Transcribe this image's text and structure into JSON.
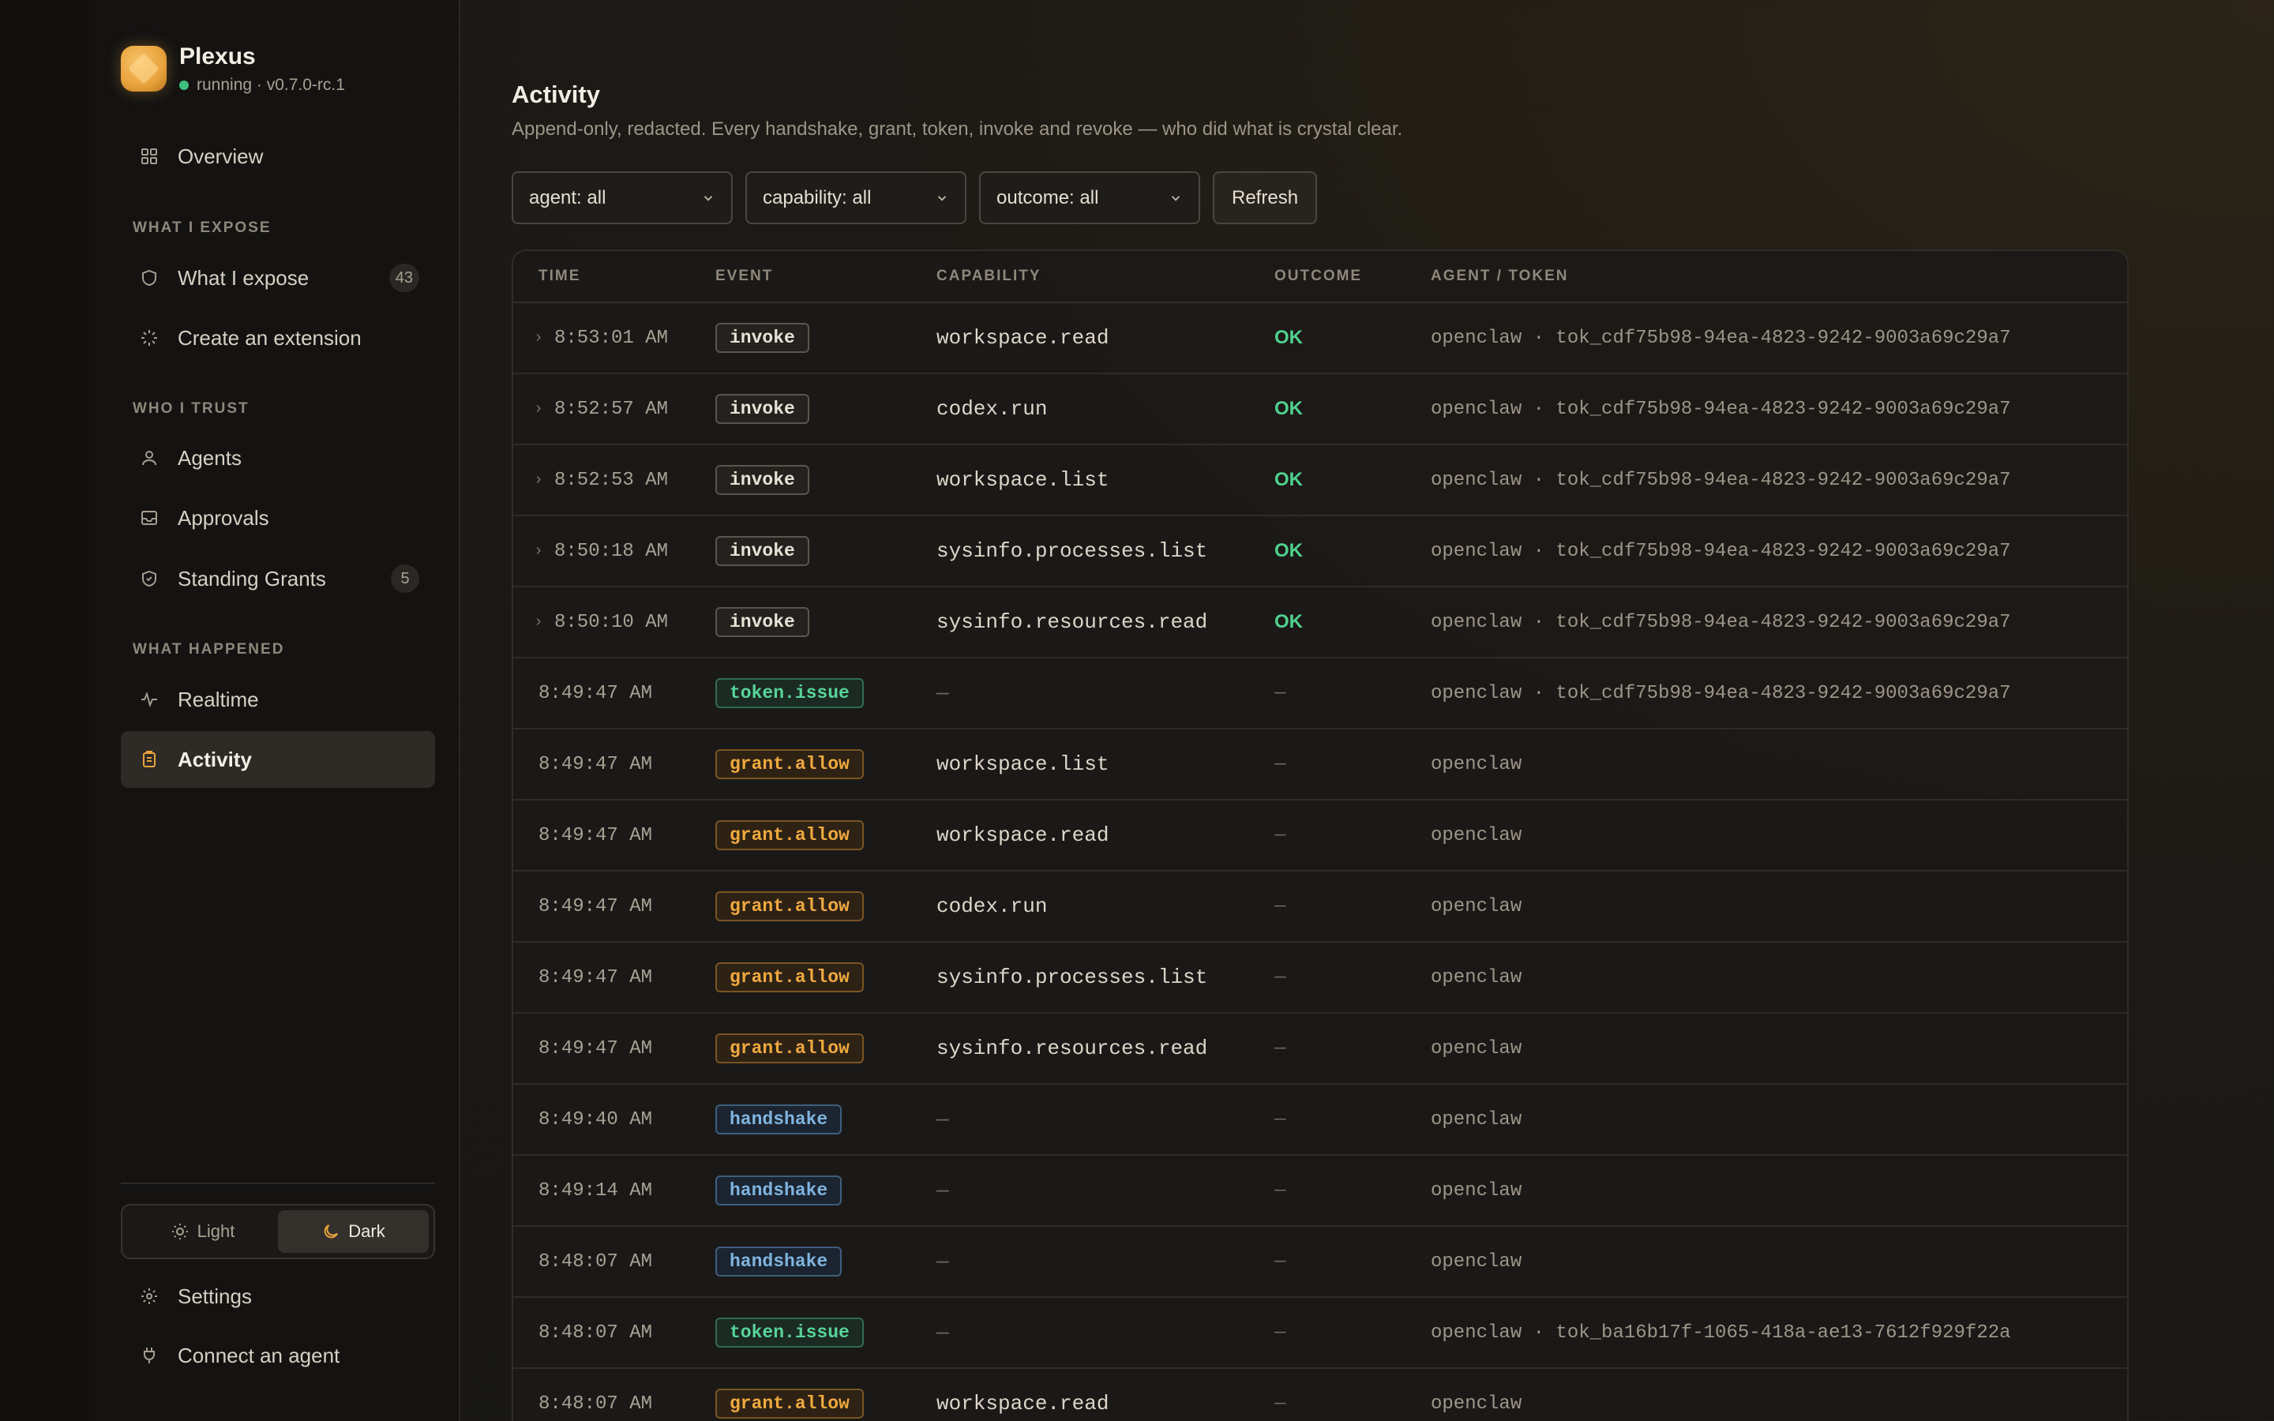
{
  "app": {
    "name": "Plexus",
    "status": "running · v0.7.0-rc.1"
  },
  "sidebar": {
    "overview": "Overview",
    "section_expose": "WHAT I EXPOSE",
    "what_i_expose": "What I expose",
    "what_i_expose_count": "43",
    "create_extension": "Create an extension",
    "section_trust": "WHO I TRUST",
    "agents": "Agents",
    "approvals": "Approvals",
    "standing_grants": "Standing Grants",
    "standing_grants_count": "5",
    "section_happened": "WHAT HAPPENED",
    "realtime": "Realtime",
    "activity": "Activity",
    "theme_light": "Light",
    "theme_dark": "Dark",
    "theme_selected": "Dark",
    "settings": "Settings",
    "connect_agent": "Connect an agent"
  },
  "page": {
    "title": "Activity",
    "subtitle": "Append-only, redacted. Every handshake, grant, token, invoke and revoke — who did what is crystal clear."
  },
  "filters": {
    "agent": "agent: all",
    "capability": "capability: all",
    "outcome": "outcome: all",
    "refresh": "Refresh"
  },
  "table": {
    "headers": {
      "time": "TIME",
      "event": "EVENT",
      "capability": "CAPABILITY",
      "outcome": "OUTCOME",
      "agent_token": "AGENT / TOKEN"
    },
    "rows": [
      {
        "expandable": true,
        "time": "8:53:01 AM",
        "event": "invoke",
        "capability": "workspace.read",
        "outcome": "OK",
        "agent": "openclaw · tok_cdf75b98-94ea-4823-9242-9003a69c29a7"
      },
      {
        "expandable": true,
        "time": "8:52:57 AM",
        "event": "invoke",
        "capability": "codex.run",
        "outcome": "OK",
        "agent": "openclaw · tok_cdf75b98-94ea-4823-9242-9003a69c29a7"
      },
      {
        "expandable": true,
        "time": "8:52:53 AM",
        "event": "invoke",
        "capability": "workspace.list",
        "outcome": "OK",
        "agent": "openclaw · tok_cdf75b98-94ea-4823-9242-9003a69c29a7"
      },
      {
        "expandable": true,
        "time": "8:50:18 AM",
        "event": "invoke",
        "capability": "sysinfo.processes.list",
        "outcome": "OK",
        "agent": "openclaw · tok_cdf75b98-94ea-4823-9242-9003a69c29a7"
      },
      {
        "expandable": true,
        "time": "8:50:10 AM",
        "event": "invoke",
        "capability": "sysinfo.resources.read",
        "outcome": "OK",
        "agent": "openclaw · tok_cdf75b98-94ea-4823-9242-9003a69c29a7"
      },
      {
        "expandable": false,
        "time": "8:49:47 AM",
        "event": "token.issue",
        "capability": "—",
        "outcome": "—",
        "agent": "openclaw · tok_cdf75b98-94ea-4823-9242-9003a69c29a7"
      },
      {
        "expandable": false,
        "time": "8:49:47 AM",
        "event": "grant.allow",
        "capability": "workspace.list",
        "outcome": "—",
        "agent": "openclaw"
      },
      {
        "expandable": false,
        "time": "8:49:47 AM",
        "event": "grant.allow",
        "capability": "workspace.read",
        "outcome": "—",
        "agent": "openclaw"
      },
      {
        "expandable": false,
        "time": "8:49:47 AM",
        "event": "grant.allow",
        "capability": "codex.run",
        "outcome": "—",
        "agent": "openclaw"
      },
      {
        "expandable": false,
        "time": "8:49:47 AM",
        "event": "grant.allow",
        "capability": "sysinfo.processes.list",
        "outcome": "—",
        "agent": "openclaw"
      },
      {
        "expandable": false,
        "time": "8:49:47 AM",
        "event": "grant.allow",
        "capability": "sysinfo.resources.read",
        "outcome": "—",
        "agent": "openclaw"
      },
      {
        "expandable": false,
        "time": "8:49:40 AM",
        "event": "handshake",
        "capability": "—",
        "outcome": "—",
        "agent": "openclaw"
      },
      {
        "expandable": false,
        "time": "8:49:14 AM",
        "event": "handshake",
        "capability": "—",
        "outcome": "—",
        "agent": "openclaw"
      },
      {
        "expandable": false,
        "time": "8:48:07 AM",
        "event": "handshake",
        "capability": "—",
        "outcome": "—",
        "agent": "openclaw"
      },
      {
        "expandable": false,
        "time": "8:48:07 AM",
        "event": "token.issue",
        "capability": "—",
        "outcome": "—",
        "agent": "openclaw · tok_ba16b17f-1065-418a-ae13-7612f929f22a"
      },
      {
        "expandable": false,
        "time": "8:48:07 AM",
        "event": "grant.allow",
        "capability": "workspace.read",
        "outcome": "—",
        "agent": "openclaw"
      }
    ]
  },
  "colors": {
    "accent": "#e8a23b",
    "ok": "#4fd18e",
    "token_issue": "#58d49a",
    "grant_allow": "#f0a93e",
    "handshake": "#7fb4e0"
  }
}
